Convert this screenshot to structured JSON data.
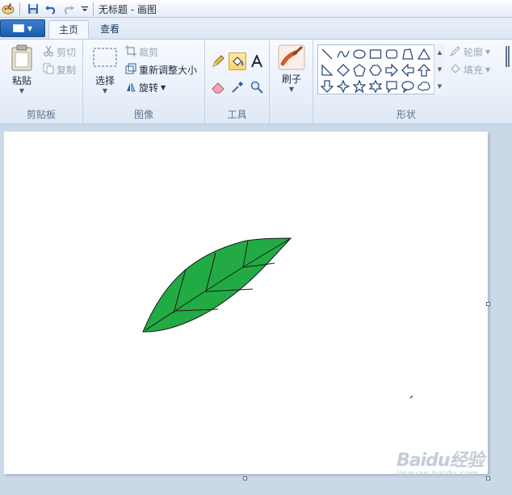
{
  "window": {
    "title": "无标题 - 画图"
  },
  "tabs": [
    {
      "label": "主页",
      "active": true
    },
    {
      "label": "查看",
      "active": false
    }
  ],
  "groups": {
    "clipboard": {
      "label": "剪贴板",
      "paste": "粘贴",
      "cut": "剪切",
      "copy": "复制"
    },
    "image": {
      "label": "图像",
      "select": "选择",
      "crop": "裁剪",
      "resize": "重新调整大小",
      "rotate": "旋转"
    },
    "tools": {
      "label": "工具",
      "items": [
        "pencil-icon",
        "fill-bucket-icon",
        "text-icon",
        "eraser-icon",
        "color-picker-icon",
        "magnifier-icon"
      ],
      "selected": "fill-bucket-icon"
    },
    "brushes": {
      "label": "刷子"
    },
    "shapes": {
      "label": "形状",
      "outline": "轮廓",
      "fill": "填充"
    }
  },
  "canvas": {
    "background": "#ffffff",
    "leaf_color": "#22aa44",
    "leaf_stroke": "#1a1a1a"
  },
  "watermark": {
    "brand": "Baidu经验",
    "url": "jingyan.baidu.com"
  }
}
